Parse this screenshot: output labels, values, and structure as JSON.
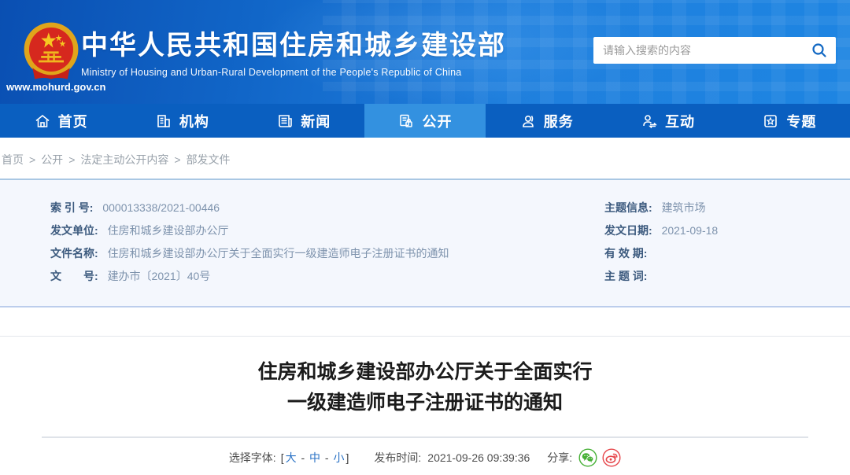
{
  "header": {
    "site_url": "www.mohurd.gov.cn",
    "title": "中华人民共和国住房和城乡建设部",
    "subtitle": "Ministry of Housing and Urban-Rural Development of the People's Republic of China",
    "search_placeholder": "请输入搜索的内容"
  },
  "nav": {
    "items": [
      {
        "label": "首页",
        "icon": "home-icon",
        "active": false
      },
      {
        "label": "机构",
        "icon": "organization-icon",
        "active": false
      },
      {
        "label": "新闻",
        "icon": "news-icon",
        "active": false
      },
      {
        "label": "公开",
        "icon": "disclosure-icon",
        "active": true
      },
      {
        "label": "服务",
        "icon": "service-icon",
        "active": false
      },
      {
        "label": "互动",
        "icon": "interaction-icon",
        "active": false
      },
      {
        "label": "专题",
        "icon": "topics-icon",
        "active": false
      }
    ]
  },
  "breadcrumb": {
    "separator": ">",
    "items": [
      "首页",
      "公开",
      "法定主动公开内容",
      "部发文件"
    ]
  },
  "info_panel": {
    "left": [
      {
        "label": "索 引 号:",
        "value": "000013338/2021-00446"
      },
      {
        "label": "发文单位:",
        "value": "住房和城乡建设部办公厅"
      },
      {
        "label": "文件名称:",
        "value": "住房和城乡建设部办公厅关于全面实行一级建造师电子注册证书的通知"
      },
      {
        "label": "文　　号:",
        "value": "建办市〔2021〕40号"
      }
    ],
    "right": [
      {
        "label": "主题信息:",
        "value": "建筑市场"
      },
      {
        "label": "发文日期:",
        "value": "2021-09-18"
      },
      {
        "label": "有 效 期:",
        "value": ""
      },
      {
        "label": "主 题 词:",
        "value": ""
      }
    ]
  },
  "document": {
    "title_line1": "住房和城乡建设部办公厅关于全面实行",
    "title_line2": "一级建造师电子注册证书的通知",
    "font_label": "选择字体:",
    "bracket_open": "[",
    "bracket_close": "]",
    "dash": " - ",
    "font_sizes": [
      "大",
      "中",
      "小"
    ],
    "publish_label": "发布时间:",
    "publish_time": "2021-09-26 09:39:36",
    "share_label": "分享:"
  },
  "colors": {
    "header_blue_dark": "#0a4fb2",
    "header_blue_light": "#1e85e2",
    "nav_blue": "#0a5fc0",
    "nav_active_blue": "#3391e0",
    "panel_bg": "#f4f7fd",
    "info_label_blue": "#3c5a7e",
    "info_value_slate": "#7e93ad",
    "link_blue": "#2a72c5",
    "wechat_green": "#45b035",
    "weibo_red": "#e6454a"
  }
}
